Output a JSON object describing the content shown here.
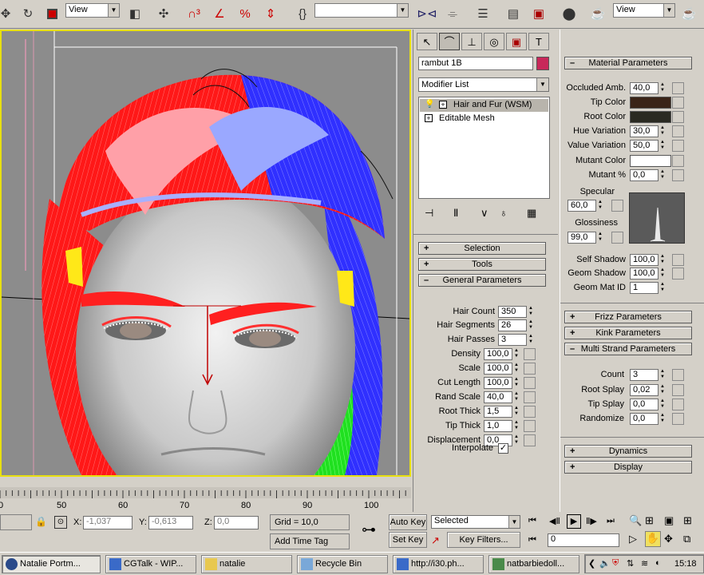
{
  "toolbar": {
    "view_select": "View",
    "view_select_right": "View",
    "named_selection": ""
  },
  "command_panel": {
    "tabs": [
      "create",
      "modify",
      "hierarchy",
      "motion",
      "display",
      "utilities"
    ],
    "object_name": "rambut 1B",
    "object_color": "#c8285a",
    "modifier_list": "Modifier List",
    "stack": [
      {
        "label": "Hair and Fur (WSM)",
        "selected": true
      },
      {
        "label": "Editable Mesh",
        "selected": false
      }
    ],
    "rollouts": {
      "selection": "Selection",
      "tools": "Tools",
      "general": "General Parameters"
    },
    "general_params": [
      {
        "label": "Hair Count",
        "value": "350"
      },
      {
        "label": "Hair Segments",
        "value": "26"
      },
      {
        "label": "Hair Passes",
        "value": "3"
      },
      {
        "label": "Density",
        "value": "100,0"
      },
      {
        "label": "Scale",
        "value": "100,0"
      },
      {
        "label": "Cut Length",
        "value": "100,0"
      },
      {
        "label": "Rand Scale",
        "value": "40,0"
      },
      {
        "label": "Root Thick",
        "value": "1,5"
      },
      {
        "label": "Tip Thick",
        "value": "1,0"
      },
      {
        "label": "Displacement",
        "value": "0,0"
      }
    ],
    "interpolate_label": "Interpolate",
    "interpolate_checked": "✓"
  },
  "material": {
    "title": "Material Parameters",
    "occluded_amb_label": "Occluded Amb.",
    "occluded_amb": "40,0",
    "tip_color_label": "Tip Color",
    "tip_color": "#3a2418",
    "root_color_label": "Root Color",
    "root_color": "#2a2a22",
    "hue_variation_label": "Hue Variation",
    "hue_variation": "30,0",
    "value_variation_label": "Value Variation",
    "value_variation": "50,0",
    "mutant_color_label": "Mutant Color",
    "mutant_color": "#ffffff",
    "mutant_pct_label": "Mutant %",
    "mutant_pct": "0,0",
    "specular_label": "Specular",
    "specular": "60,0",
    "glossiness_label": "Glossiness",
    "glossiness": "99,0",
    "self_shadow_label": "Self Shadow",
    "self_shadow": "100,0",
    "geom_shadow_label": "Geom Shadow",
    "geom_shadow": "100,0",
    "geom_mat_id_label": "Geom Mat ID",
    "geom_mat_id": "1"
  },
  "right_rollouts": {
    "frizz": "Frizz Parameters",
    "kink": "Kink Parameters",
    "multi_strand": "Multi Strand Parameters",
    "dynamics": "Dynamics",
    "display": "Display"
  },
  "multi_strand": {
    "count_label": "Count",
    "count": "3",
    "root_splay_label": "Root Splay",
    "root_splay": "0,02",
    "tip_splay_label": "Tip Splay",
    "tip_splay": "0,0",
    "randomize_label": "Randomize",
    "randomize": "0,0"
  },
  "timeline": {
    "ticks": [
      "50",
      "60",
      "70",
      "80",
      "90",
      "100"
    ],
    "first_tick": "0"
  },
  "status": {
    "x_label": "X:",
    "x": "-1,037",
    "y_label": "Y:",
    "y": "-0,613",
    "z_label": "Z:",
    "z": "0,0",
    "grid": "Grid = 10,0",
    "add_time_tag": "Add Time Tag",
    "auto_key": "Auto Key",
    "set_key": "Set Key",
    "selected": "Selected",
    "key_filters": "Key Filters...",
    "frame": "0"
  },
  "taskbar": {
    "items": [
      {
        "label": "Natalie Portm...",
        "icon": "max-icon"
      },
      {
        "label": "CGTalk - WIP...",
        "icon": "browser-icon"
      },
      {
        "label": "natalie",
        "icon": "folder-icon"
      },
      {
        "label": "Recycle Bin",
        "icon": "recycle-icon"
      },
      {
        "label": "http://i30.ph...",
        "icon": "browser-icon"
      },
      {
        "label": "natbarbiedoll...",
        "icon": "image-icon"
      }
    ],
    "clock": "15:18"
  }
}
